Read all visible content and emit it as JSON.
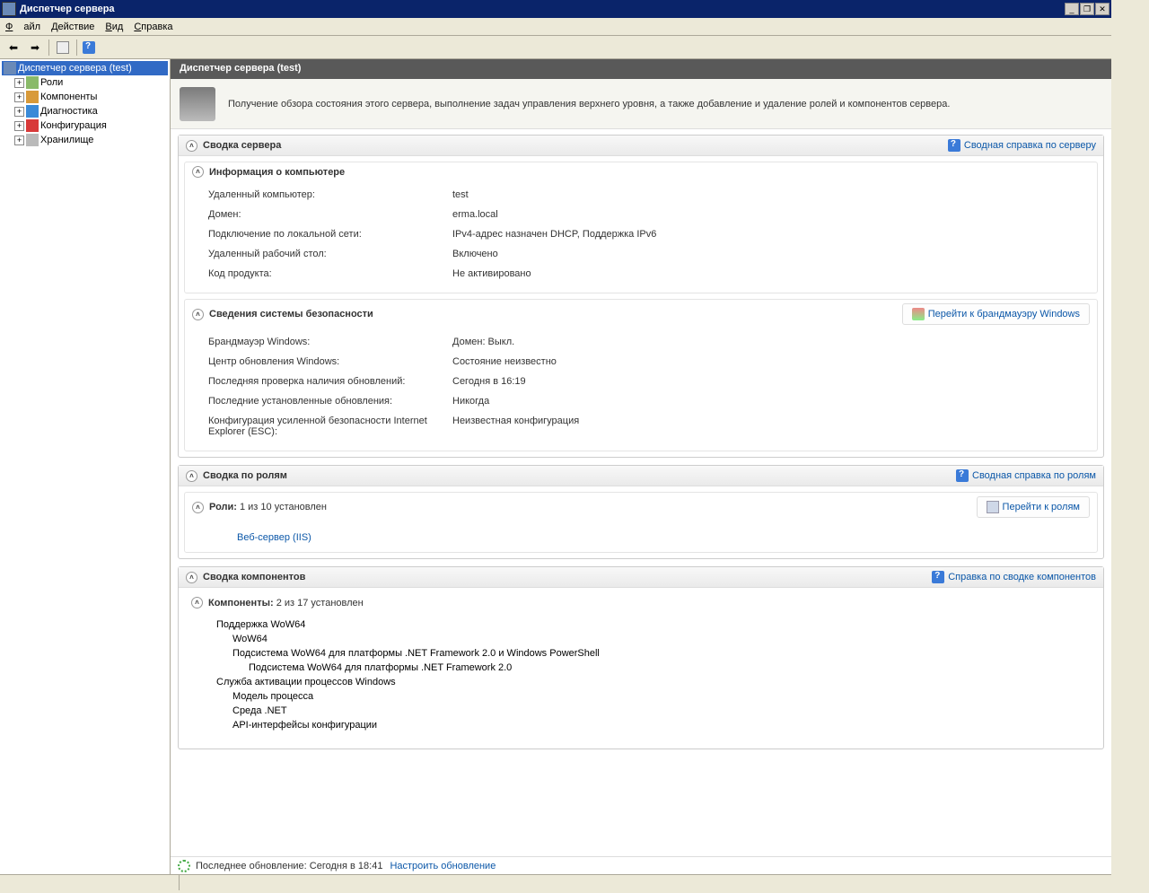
{
  "window": {
    "title": "Диспетчер сервера"
  },
  "menu": {
    "file": "Файл",
    "action": "Действие",
    "view": "Вид",
    "help": "Справка",
    "file_u": "Ф",
    "action_u": "Д",
    "view_u": "В",
    "help_u": "С"
  },
  "tree": {
    "root": "Диспетчер сервера (test)",
    "items": [
      {
        "label": "Роли"
      },
      {
        "label": "Компоненты"
      },
      {
        "label": "Диагностика"
      },
      {
        "label": "Конфигурация"
      },
      {
        "label": "Хранилище"
      }
    ]
  },
  "header": {
    "title": "Диспетчер сервера (test)"
  },
  "intro": {
    "text": "Получение обзора состояния этого сервера, выполнение задач управления верхнего уровня, а также добавление и удаление ролей и компонентов сервера."
  },
  "summary": {
    "title": "Сводка сервера",
    "help": "Сводная справка по серверу",
    "computer": {
      "title": "Информация о компьютере",
      "rows": [
        {
          "label": "Удаленный компьютер:",
          "value": "test"
        },
        {
          "label": "Домен:",
          "value": "erma.local"
        },
        {
          "label": "Подключение по локальной сети:",
          "value": "IPv4-адрес назначен DHCP, Поддержка IPv6"
        },
        {
          "label": "Удаленный рабочий стол:",
          "value": "Включено"
        },
        {
          "label": "Код продукта:",
          "value": "Не активировано"
        }
      ]
    },
    "security": {
      "title": "Сведения системы безопасности",
      "link": "Перейти к брандмауэру Windows",
      "rows": [
        {
          "label": "Брандмауэр Windows:",
          "value": "Домен: Выкл."
        },
        {
          "label": "Центр обновления Windows:",
          "value": "Состояние неизвестно"
        },
        {
          "label": "Последняя проверка наличия обновлений:",
          "value": "Сегодня в 16:19"
        },
        {
          "label": "Последние установленные обновления:",
          "value": "Никогда"
        },
        {
          "label": "Конфигурация усиленной безопасности Internet Explorer (ESC):",
          "value": "Неизвестная конфигурация"
        }
      ]
    }
  },
  "roles": {
    "title": "Сводка по ролям",
    "help": "Сводная справка по ролям",
    "subtitle": "Роли:",
    "count": "1 из 10 установлен",
    "goto": "Перейти к ролям",
    "item": "Веб-сервер (IIS)"
  },
  "components": {
    "title": "Сводка компонентов",
    "help": "Справка по сводке компонентов",
    "subtitle": "Компоненты:",
    "count": "2 из 17 установлен",
    "list": [
      {
        "t": "Поддержка WoW64",
        "l": 0
      },
      {
        "t": "WoW64",
        "l": 1
      },
      {
        "t": "Подсистема WoW64 для платформы .NET Framework 2.0 и Windows PowerShell",
        "l": 1
      },
      {
        "t": "Подсистема WoW64 для платформы .NET Framework 2.0",
        "l": 2
      },
      {
        "t": "Служба активации процессов Windows",
        "l": 0
      },
      {
        "t": "Модель процесса",
        "l": 1
      },
      {
        "t": "Среда .NET",
        "l": 1
      },
      {
        "t": "API-интерфейсы конфигурации",
        "l": 1
      }
    ]
  },
  "footer": {
    "lastupdate_label": "Последнее обновление:",
    "lastupdate_value": "Сегодня в 18:41",
    "configure": "Настроить обновление"
  }
}
